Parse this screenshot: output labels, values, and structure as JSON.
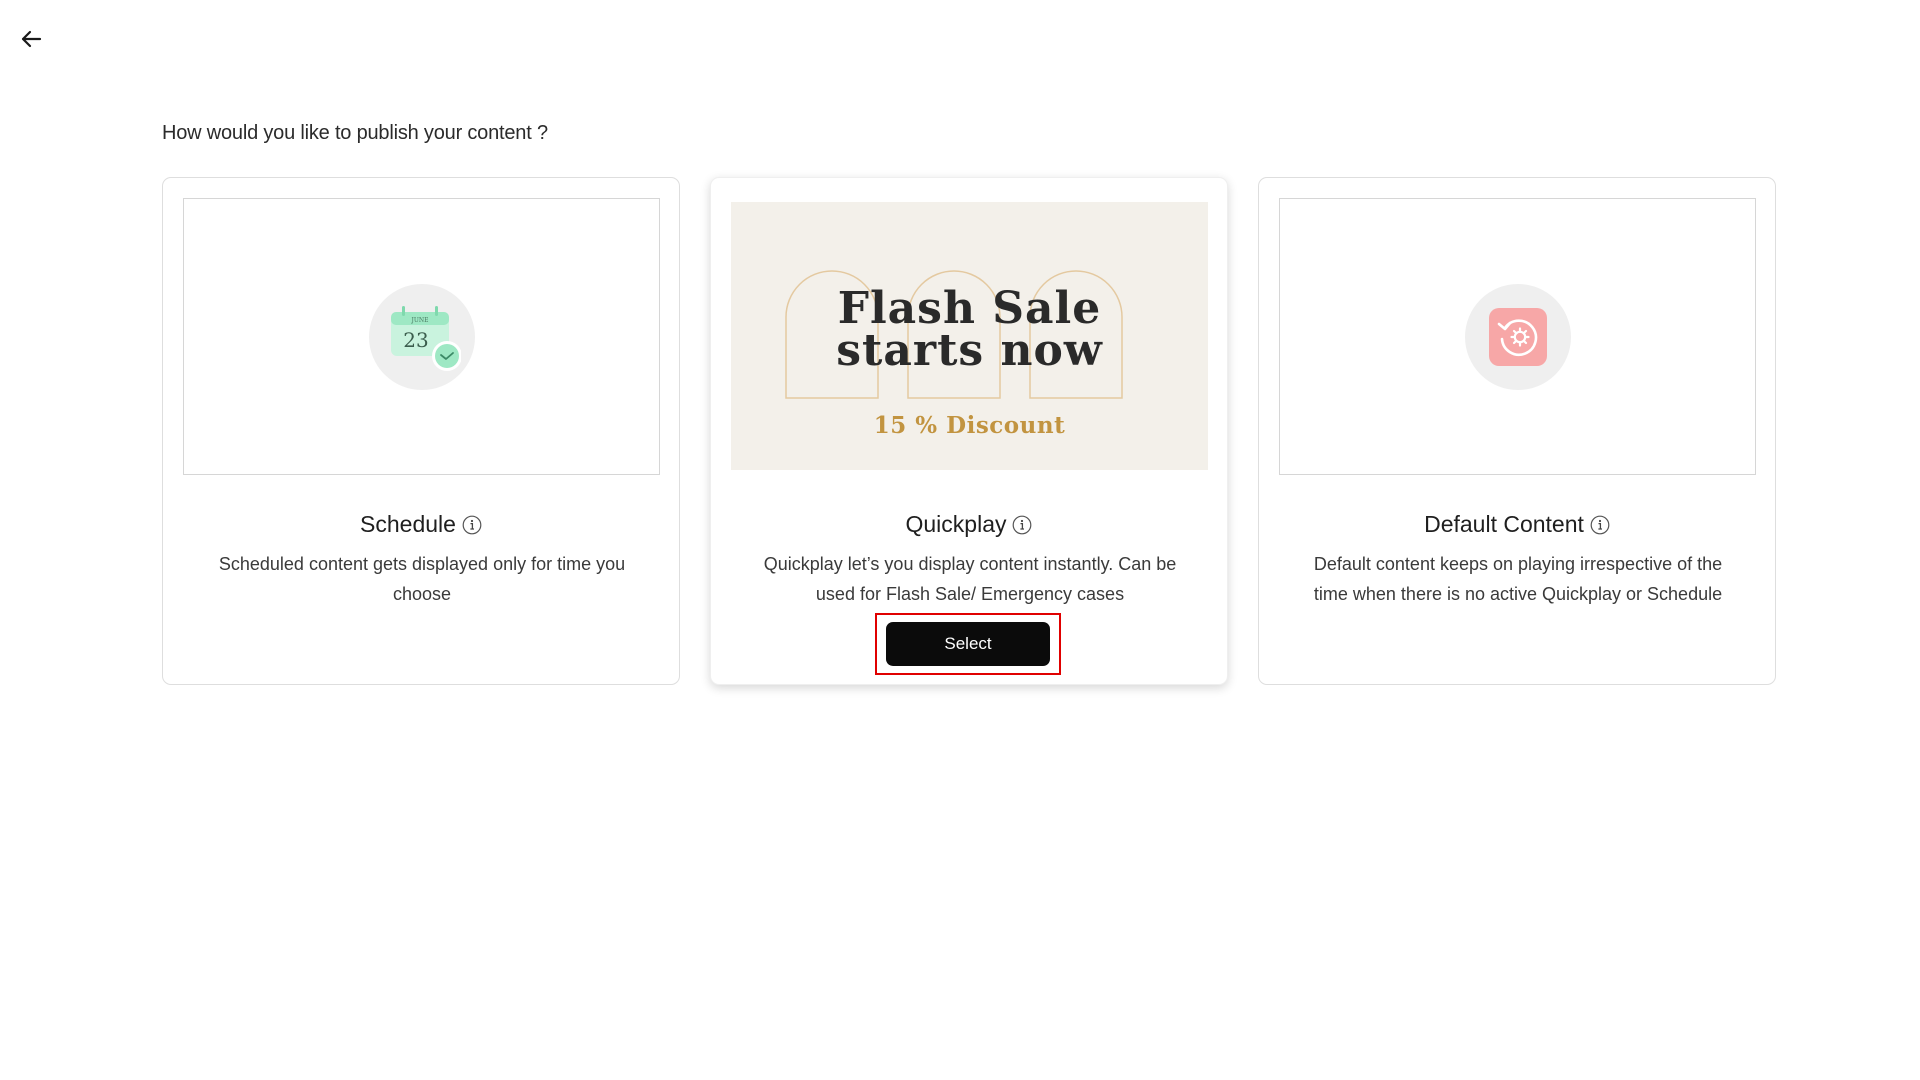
{
  "header": {
    "back_icon": "arrow-left-icon",
    "title": "How would you like to publish your content ?"
  },
  "cards": [
    {
      "id": "schedule",
      "heading": "Schedule",
      "description": "Scheduled content gets displayed only for time you choose",
      "icon": "calendar-clock-icon",
      "calendar_month": "JUNE",
      "calendar_day": "23",
      "accent_color": "#9ee8c4"
    },
    {
      "id": "quickplay",
      "heading": "Quickplay",
      "description": "Quickplay let’s you display content instantly. Can be used for Flash Sale/ Emergency cases",
      "preview": {
        "title_line1": "Flash Sale",
        "title_line2": "starts now",
        "discount": "15 % Discount",
        "background_color": "#f3f0ea",
        "accent_color": "#c29440"
      },
      "button_label": "Select",
      "selected": true
    },
    {
      "id": "default",
      "heading": "Default Content",
      "description": "Default content keeps on playing irrespective of the time when there is no active Quickplay or Schedule",
      "icon": "default-content-replay-icon",
      "accent_color": "#f4a3a3"
    }
  ]
}
